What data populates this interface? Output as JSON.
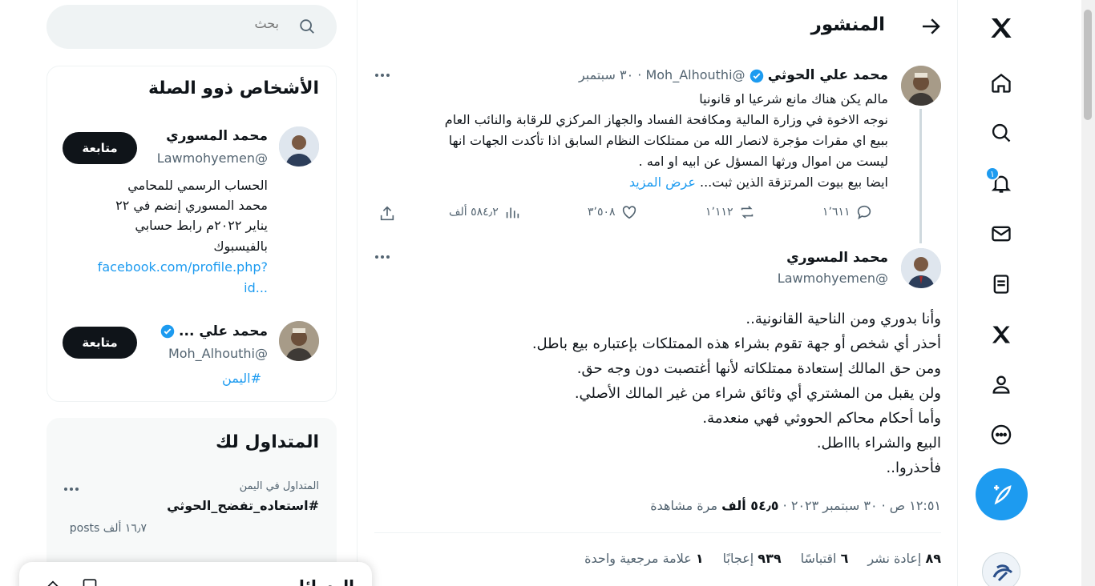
{
  "header": {
    "title": "المنشور"
  },
  "nav": {
    "notification_count": "١"
  },
  "parent_tweet": {
    "name": "محمد علي الحوثي",
    "handle": "@Moh_Alhouthi",
    "date": "· ٣٠ سبتمبر",
    "lines": [
      "مالم يكن هناك مانع شرعيا او قانونيا",
      "نوجه الاخوة في وزارة المالية ومكافحة الفساد والجهاز المركزي للرقابة والنائب العام",
      "ببيع اي مقرات مؤجرة لانصار الله من ممتلكات النظام السابق اذا تأكدت الجهات انها",
      "ليست من اموال ورثها المسؤل عن ابيه او امه .",
      "ايضا بيع بيوت المرتزقة الذين ثبت..."
    ],
    "show_more": "عرض المزيد",
    "replies": "١٬٦١١",
    "retweets": "١٬١١٢",
    "likes": "٣٬٥٠٨",
    "views": "٥٨٤٫٢ ألف"
  },
  "main_tweet": {
    "name": "محمد المسوري",
    "handle": "@Lawmohyemen",
    "lines": [
      "وأنا بدوري ومن الناحية القانونية..",
      "أحذر أي شخص أو جهة تقوم بشراء هذه الممتلكات بإعتباره بيع باطل.",
      "ومن حق المالك إستعادة ممتلكاته لأنها أغتصبت دون وجه حق.",
      "ولن يقبل من المشتري أي وثائق شراء من غير المالك الأصلي.",
      "وأما أحكام محاكم الحووثي فهي منعدمة.",
      "البيع والشراء باااطل.",
      "فأحذروا.."
    ],
    "time": "١٢:٥١ ص · ٣٠ سبتمبر ٢٠٢٣ ·",
    "views_count": "٥٤٫٥ ألف",
    "views_label": "مرة مشاهدة",
    "reposts_count": "٨٩",
    "reposts_label": "إعادة نشر",
    "quotes_count": "٦",
    "quotes_label": "اقتباسًا",
    "likes_count": "٩٣٩",
    "likes_label": "إعجابًا",
    "bookmarks_count": "١",
    "bookmarks_label": "علامة مرجعية واحدة"
  },
  "search": {
    "placeholder": "بحث"
  },
  "related_people": {
    "title": "الأشخاص ذوو الصلة",
    "people": [
      {
        "name": "محمد المسوري",
        "handle": "@Lawmohyemen",
        "follow_label": "متابعة",
        "bio_lines": [
          "الحساب الرسمي للمحامي",
          "محمد المسوري إنضم في ٢٢",
          "يناير ٢٠٢٢م رابط حسابي",
          "بالفيسبوك"
        ],
        "link_lines": [
          "facebook.com/profile.php?",
          "id..."
        ]
      },
      {
        "name": "محمد علي ...",
        "handle": "@Moh_Alhouthi",
        "follow_label": "متابعة",
        "hashtag": "#اليمن"
      }
    ]
  },
  "trending": {
    "title": "المتداول لك",
    "items": [
      {
        "context": "المتداول في اليمن",
        "tag": "#استعاده_تفضح_الحوثي",
        "count": "١٦٫٧ ألف posts"
      }
    ]
  },
  "messages": {
    "title": "الرسائل"
  },
  "colors": {
    "accent": "#1d9bf0",
    "text": "#0f1419",
    "muted": "#536471"
  }
}
